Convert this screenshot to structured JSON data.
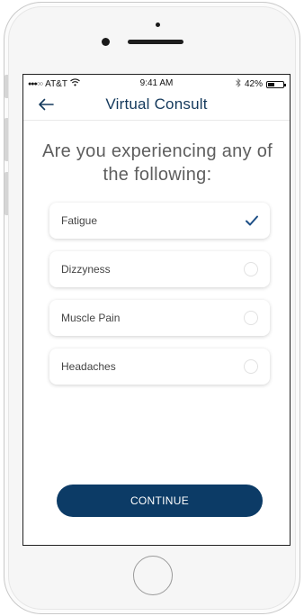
{
  "status_bar": {
    "signal_dots": "●●●○○",
    "carrier": "AT&T",
    "wifi_icon": "wifi-icon",
    "time": "9:41 AM",
    "bluetooth_icon": "bluetooth-icon",
    "battery_percent": "42%",
    "battery_level": 0.42
  },
  "nav": {
    "back_icon": "arrow-left-icon",
    "title": "Virtual Consult"
  },
  "question": "Are you experiencing any of the following:",
  "options": [
    {
      "label": "Fatigue",
      "selected": true
    },
    {
      "label": "Dizzyness",
      "selected": false
    },
    {
      "label": "Muscle Pain",
      "selected": false
    },
    {
      "label": "Headaches",
      "selected": false
    }
  ],
  "continue_label": "CONTINUE",
  "colors": {
    "brand_navy": "#0c3b66",
    "title_navy": "#14395c",
    "check_blue": "#1d4f86"
  }
}
